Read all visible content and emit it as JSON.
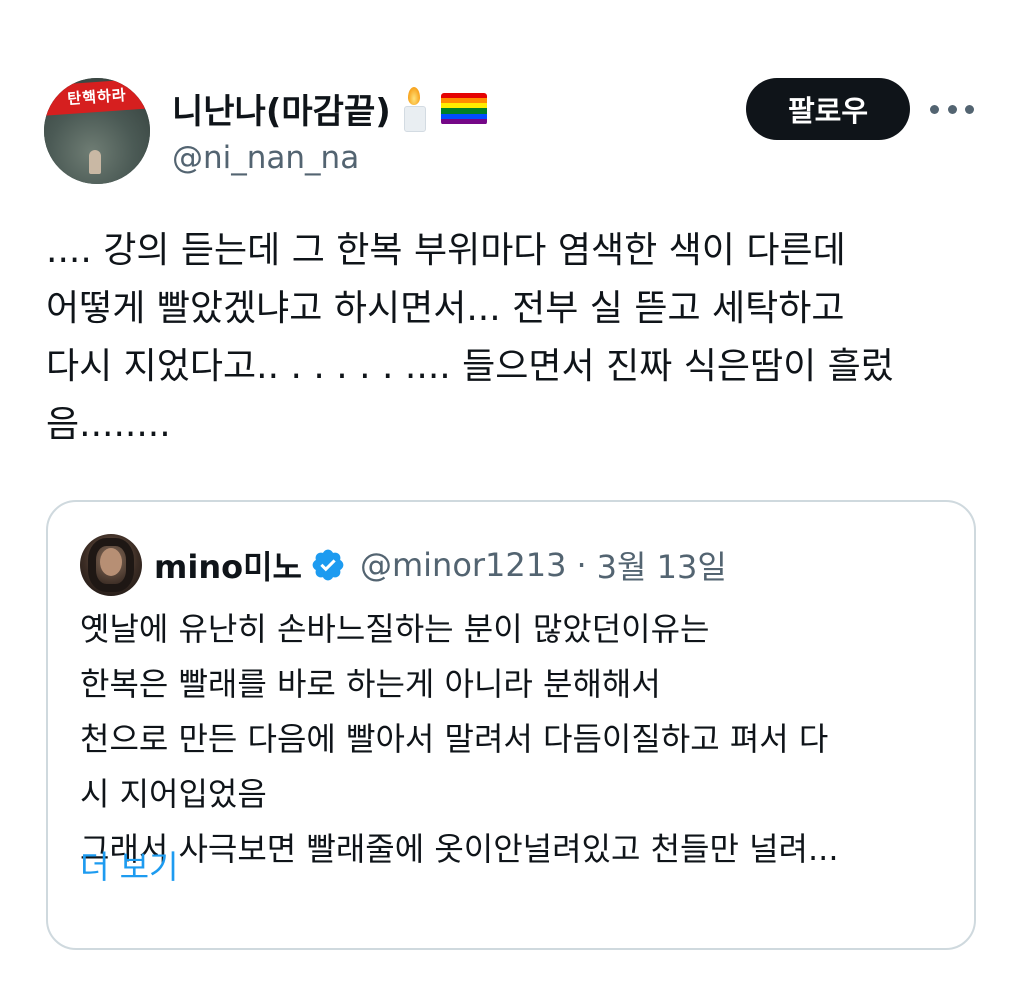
{
  "author": {
    "display_name": "니난나(마감끝)",
    "handle": "@ni_nan_na",
    "avatar_banner_text": "탄핵하라",
    "emojis": [
      "candle-icon",
      "rainbow-flag-icon"
    ]
  },
  "actions": {
    "follow_label": "팔로우",
    "more_icon": "more-icon"
  },
  "tweet": {
    "text": ".... 강의 듣는데 그 한복 부위마다 염색한 색이 다른데\n어떻게 빨았겠냐고 하시면서... 전부 실 뜯고 세탁하고\n다시 지었다고.. . . . . . .... 들으면서 진짜 식은땀이 흘렀\n음........"
  },
  "quote": {
    "name": "mino미노",
    "handle": "@minor1213",
    "separator": "·",
    "date": "3월 13일",
    "text": "옛날에 유난히 손바느질하는 분이 많았던이유는\n한복은 빨래를 바로 하는게 아니라 분해해서\n천으로 만든 다음에 빨아서 말려서 다듬이질하고 펴서 다\n시 지어입었음\n그래서 사극보면 빨래줄에 옷이안널려있고 천들만 널려...",
    "show_more": "더 보기"
  },
  "colors": {
    "text_primary": "#0f1419",
    "text_secondary": "#536471",
    "link": "#1d9bf0",
    "verified": "#1d9bf0",
    "button_bg": "#0f1419",
    "border": "#cfd9de",
    "rainbow": [
      "#e40303",
      "#ff8c00",
      "#ffed00",
      "#008026",
      "#004dff",
      "#750787"
    ]
  }
}
